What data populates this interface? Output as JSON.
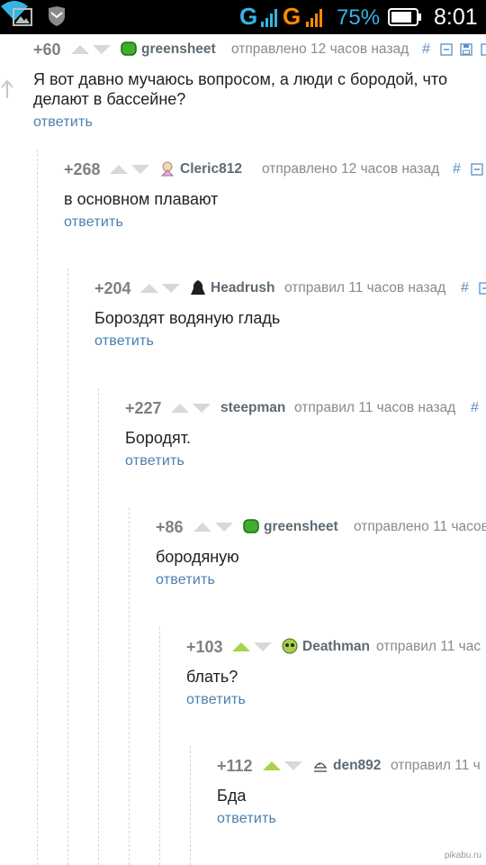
{
  "status_bar": {
    "network_1": "G",
    "network_2": "G",
    "battery_percent": "75%",
    "clock": "8:01",
    "accent_color": "#33b5e5"
  },
  "thread": {
    "reply_label": "ответить",
    "comments": [
      {
        "rating": "+60",
        "user": "greensheet",
        "avatar_icon": "green-blob-avatar-icon",
        "time": "отправлено 12 часов назад",
        "hash": "#",
        "text_lines": [
          "Я вот давно мучаюсь вопросом, а люди с бородой, что",
          "делают в бассейне?"
        ],
        "upvoted": false
      },
      {
        "rating": "+268",
        "user": "Cleric812",
        "avatar_icon": "cleric-avatar-icon",
        "time": "отправлено 12 часов назад",
        "hash": "#",
        "text_lines": [
          "в основном плавают"
        ],
        "upvoted": false
      },
      {
        "rating": "+204",
        "user": "Headrush",
        "avatar_icon": "dark-figure-avatar-icon",
        "time": "отправил 11 часов назад",
        "hash": "#",
        "text_lines": [
          "Бороздят водяную гладь"
        ],
        "upvoted": false
      },
      {
        "rating": "+227",
        "user": "steepman",
        "avatar_icon": "",
        "time": "отправил 11 часов назад",
        "hash": "#",
        "text_lines": [
          "Бородят."
        ],
        "upvoted": false
      },
      {
        "rating": "+86",
        "user": "greensheet",
        "avatar_icon": "green-blob-avatar-icon",
        "time": "отправлено 11 часов",
        "hash": "",
        "text_lines": [
          "бородяную"
        ],
        "upvoted": false
      },
      {
        "rating": "+103",
        "user": "Deathman",
        "avatar_icon": "green-skull-avatar-icon",
        "time": "отправил 11 час",
        "hash": "",
        "text_lines": [
          "блать?"
        ],
        "upvoted": true
      },
      {
        "rating": "+112",
        "user": "den892",
        "avatar_icon": "sketch-face-avatar-icon",
        "time": "отправил 11 ч",
        "hash": "",
        "text_lines": [
          "Бда"
        ],
        "upvoted": true
      }
    ]
  },
  "watermark": "pikabu.ru",
  "colors": {
    "upvote_active": "#a8d44a",
    "vote_inactive": "#d8d8d8",
    "link": "#4a7fb0",
    "username": "#5f6a72"
  }
}
